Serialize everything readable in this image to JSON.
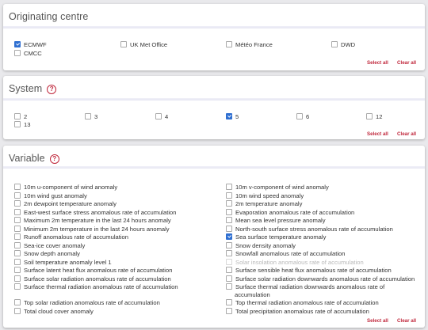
{
  "originating_centre": {
    "title": "Originating centre",
    "options": [
      {
        "label": "ECMWF",
        "checked": true
      },
      {
        "label": "UK Met Office",
        "checked": false
      },
      {
        "label": "Météo France",
        "checked": false
      },
      {
        "label": "DWD",
        "checked": false
      },
      {
        "label": "CMCC",
        "checked": false
      }
    ],
    "select_all": "Select all",
    "clear_all": "Clear all"
  },
  "system": {
    "title": "System",
    "options": [
      {
        "label": "2",
        "checked": false
      },
      {
        "label": "3",
        "checked": false
      },
      {
        "label": "4",
        "checked": false
      },
      {
        "label": "5",
        "checked": true
      },
      {
        "label": "6",
        "checked": false
      },
      {
        "label": "12",
        "checked": false
      },
      {
        "label": "13",
        "checked": false
      }
    ],
    "select_all": "Select all",
    "clear_all": "Clear all"
  },
  "variable": {
    "title": "Variable",
    "options": [
      {
        "label": "10m u-component of wind anomaly",
        "checked": false
      },
      {
        "label": "10m v-component of wind anomaly",
        "checked": false
      },
      {
        "label": "10m wind gust anomaly",
        "checked": false
      },
      {
        "label": "10m wind speed anomaly",
        "checked": false
      },
      {
        "label": "2m dewpoint temperature anomaly",
        "checked": false
      },
      {
        "label": "2m temperature anomaly",
        "checked": false
      },
      {
        "label": "East-west surface stress anomalous rate of accumulation",
        "checked": false
      },
      {
        "label": "Evaporation anomalous rate of accumulation",
        "checked": false
      },
      {
        "label": "Maximum 2m temperature in the last 24 hours anomaly",
        "checked": false
      },
      {
        "label": "Mean sea level pressure anomaly",
        "checked": false
      },
      {
        "label": "Minimum 2m temperature in the last 24 hours anomaly",
        "checked": false
      },
      {
        "label": "North-south surface stress anomalous rate of accumulation",
        "checked": false
      },
      {
        "label": "Runoff anomalous rate of accumulation",
        "checked": false
      },
      {
        "label": "Sea surface temperature anomaly",
        "checked": true
      },
      {
        "label": "Sea-ice cover anomaly",
        "checked": false
      },
      {
        "label": "Snow density anomaly",
        "checked": false
      },
      {
        "label": "Snow depth anomaly",
        "checked": false
      },
      {
        "label": "Snowfall anomalous rate of accumulation",
        "checked": false
      },
      {
        "label": "Soil temperature anomaly level 1",
        "checked": false
      },
      {
        "label": "Solar insolation anomalous rate of accumulation",
        "checked": false,
        "disabled": true
      },
      {
        "label": "Surface latent heat flux anomalous rate of accumulation",
        "checked": false
      },
      {
        "label": "Surface sensible heat flux anomalous rate of accumulation",
        "checked": false
      },
      {
        "label": "Surface solar radiation anomalous rate of accumulation",
        "checked": false
      },
      {
        "label": "Surface solar radiation downwards anomalous rate of accumulation",
        "checked": false
      },
      {
        "label": "Surface thermal radiation anomalous rate of accumulation",
        "checked": false
      },
      {
        "label": "Surface thermal radiation downwards anomalous rate of",
        "label_cont": "accumulation",
        "checked": false
      },
      {
        "label": "Top solar radiation anomalous rate of accumulation",
        "checked": false
      },
      {
        "label": "Top thermal radiation anomalous rate of accumulation",
        "checked": false
      },
      {
        "label": "Total cloud cover anomaly",
        "checked": false
      },
      {
        "label": "Total precipitation anomalous rate of accumulation",
        "checked": false
      }
    ],
    "select_all": "Select all",
    "clear_all": "Clear all"
  },
  "colors": {
    "accent": "#c0283c",
    "checkbox_checked": "#2f6fd1"
  }
}
